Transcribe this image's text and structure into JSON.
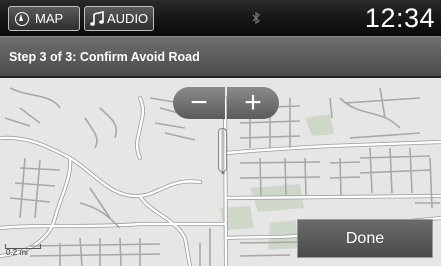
{
  "topbar": {
    "map_label": "MAP",
    "audio_label": "AUDIO",
    "clock": "12:34",
    "bluetooth_glyph": "ʙ"
  },
  "step": {
    "title": "Step 3 of 3: Confirm Avoid Road"
  },
  "map": {
    "scale_label": "0.2 mi"
  },
  "zoom": {
    "out_label": "−",
    "in_label": "+"
  },
  "done_label": "Done",
  "icons": {
    "map_tab": "compass-icon",
    "audio_tab": "music-note-icon",
    "status": "bluetooth-icon"
  },
  "colors": {
    "map_bg": "#e6e6e6",
    "road": "#ffffff",
    "road_outline": "#9a9a9a",
    "park": "#c9d6c4"
  }
}
